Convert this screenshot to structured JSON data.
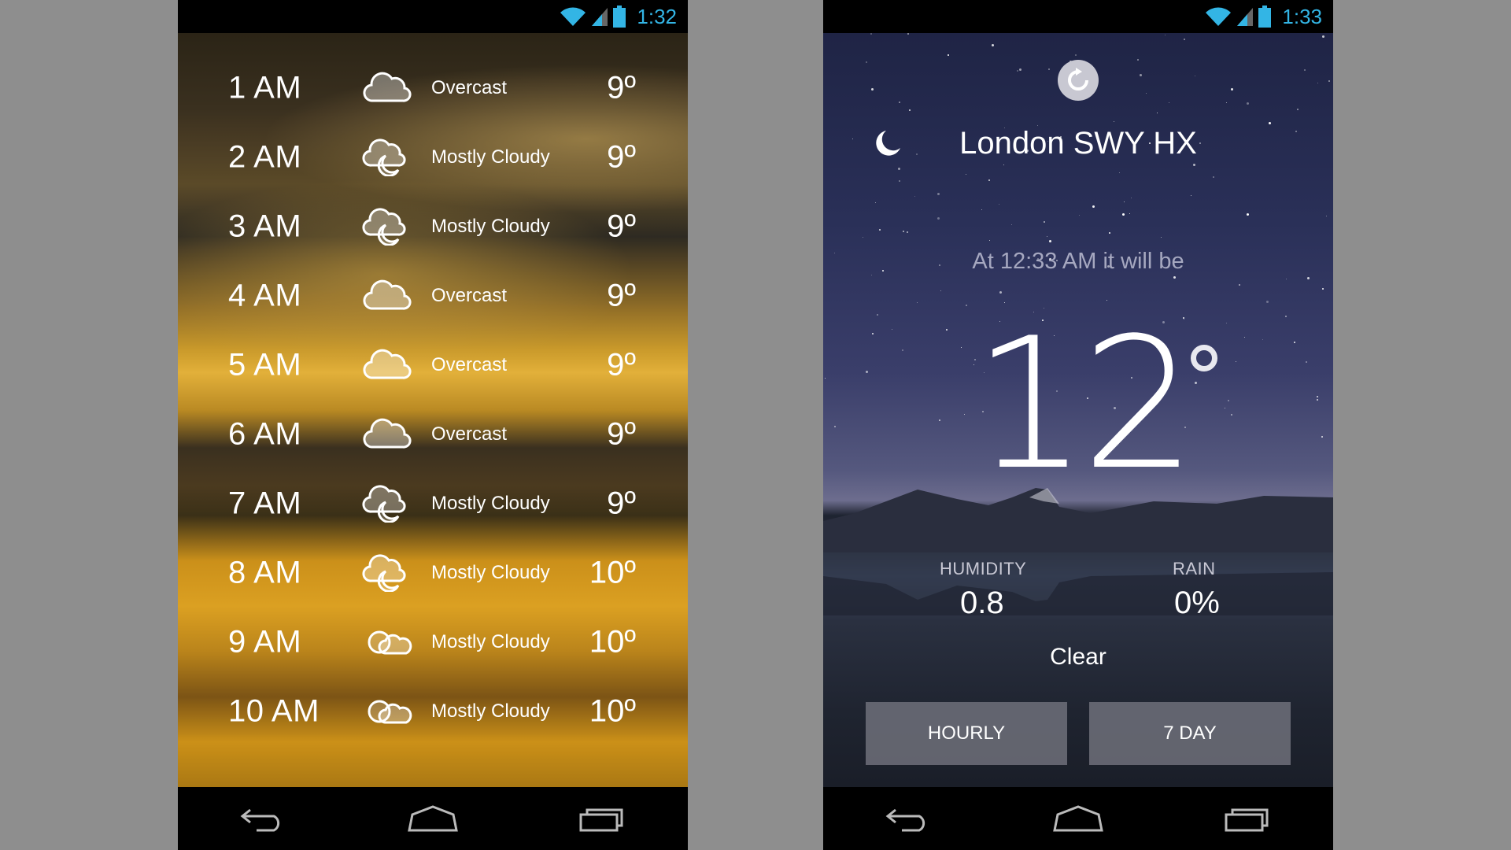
{
  "left_phone": {
    "status_time": "1:32",
    "hours": [
      {
        "time": "1 AM",
        "icon": "overcast-icon",
        "condition": "Overcast",
        "temp": "9º"
      },
      {
        "time": "2 AM",
        "icon": "mostly-cloudy-night-icon",
        "condition": "Mostly Cloudy",
        "temp": "9º"
      },
      {
        "time": "3 AM",
        "icon": "mostly-cloudy-night-icon",
        "condition": "Mostly Cloudy",
        "temp": "9º"
      },
      {
        "time": "4 AM",
        "icon": "overcast-icon",
        "condition": "Overcast",
        "temp": "9º"
      },
      {
        "time": "5 AM",
        "icon": "overcast-icon",
        "condition": "Overcast",
        "temp": "9º"
      },
      {
        "time": "6 AM",
        "icon": "overcast-icon",
        "condition": "Overcast",
        "temp": "9º"
      },
      {
        "time": "7 AM",
        "icon": "mostly-cloudy-night-icon",
        "condition": "Mostly Cloudy",
        "temp": "9º"
      },
      {
        "time": "8 AM",
        "icon": "mostly-cloudy-night-icon",
        "condition": "Mostly Cloudy",
        "temp": "10º"
      },
      {
        "time": "9 AM",
        "icon": "mostly-cloudy-day-icon",
        "condition": "Mostly Cloudy",
        "temp": "10º"
      },
      {
        "time": "10 AM",
        "icon": "mostly-cloudy-day-icon",
        "condition": "Mostly Cloudy",
        "temp": "10º"
      }
    ]
  },
  "right_phone": {
    "status_time": "1:33",
    "location": "London SWY HX",
    "subtitle": "At 12:33 AM it will be",
    "temperature": "12",
    "humidity_label": "HUMIDITY",
    "humidity_value": "0.8",
    "rain_label": "RAIN",
    "rain_value": "0%",
    "condition": "Clear",
    "hourly_button": "HOURLY",
    "seven_day_button": "7 DAY"
  },
  "colors": {
    "status_accent": "#33b5e5",
    "background": "#8e8e8e"
  }
}
